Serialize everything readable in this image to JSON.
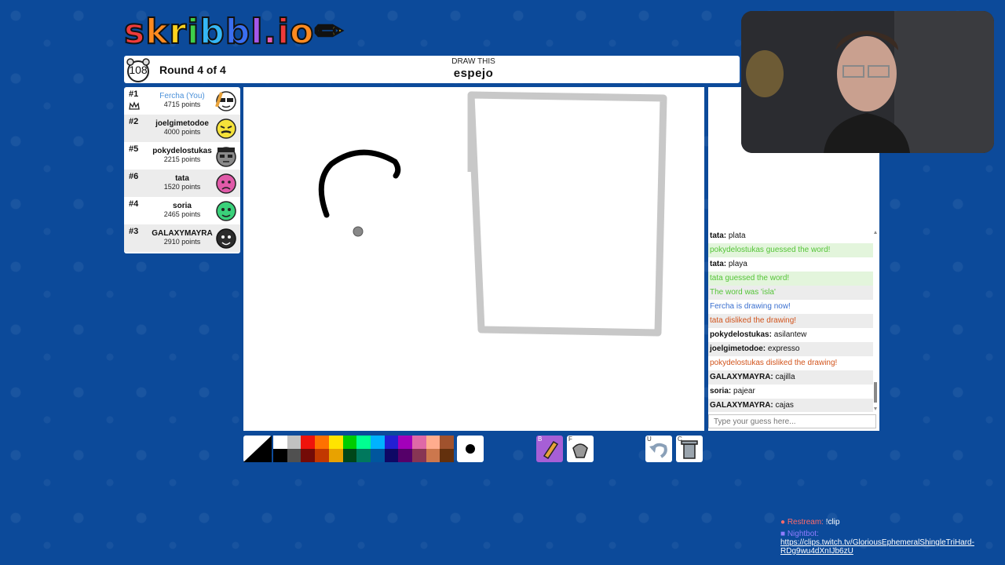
{
  "logo": {
    "text": "skribbl.io"
  },
  "header": {
    "timer": "108",
    "round": "Round 4 of 4",
    "draw_this": "DRAW THIS",
    "word": "espejo"
  },
  "players": [
    {
      "rank": "#1",
      "name": "Fercha (You)",
      "points": "4715 points",
      "you": true,
      "avatar_color": "#ffffff"
    },
    {
      "rank": "#2",
      "name": "joelgimetodoe",
      "points": "4000 points",
      "you": false,
      "avatar_color": "#f5e23a"
    },
    {
      "rank": "#5",
      "name": "pokydelostukas",
      "points": "2215 points",
      "you": false,
      "avatar_color": "#8a8a8a"
    },
    {
      "rank": "#6",
      "name": "tata",
      "points": "1520 points",
      "you": false,
      "avatar_color": "#e05aa8"
    },
    {
      "rank": "#4",
      "name": "soria",
      "points": "2465 points",
      "you": false,
      "avatar_color": "#3ad17a"
    },
    {
      "rank": "#3",
      "name": "GALAXYMAYRA",
      "points": "2910 points",
      "you": false,
      "avatar_color": "#2b2b2b"
    }
  ],
  "chat": {
    "messages": [
      {
        "user": "tata:",
        "text": "plata",
        "style": "normal"
      },
      {
        "user": "",
        "text": "pokydelostukas guessed the word!",
        "style": "green"
      },
      {
        "user": "tata:",
        "text": "playa",
        "style": "normal"
      },
      {
        "user": "",
        "text": "tata guessed the word!",
        "style": "green"
      },
      {
        "user": "",
        "text": "The word was 'isla'",
        "style": "green"
      },
      {
        "user": "",
        "text": "Fercha is drawing now!",
        "style": "blue"
      },
      {
        "user": "",
        "text": "tata disliked the drawing!",
        "style": "orange"
      },
      {
        "user": "pokydelostukas:",
        "text": "asilantew",
        "style": "normal"
      },
      {
        "user": "joelgimetodoe:",
        "text": "expresso",
        "style": "normal"
      },
      {
        "user": "",
        "text": "pokydelostukas disliked the drawing!",
        "style": "orange"
      },
      {
        "user": "GALAXYMAYRA:",
        "text": "cajilla",
        "style": "normal"
      },
      {
        "user": "soria:",
        "text": "pajear",
        "style": "normal"
      },
      {
        "user": "GALAXYMAYRA:",
        "text": "cajas",
        "style": "normal"
      }
    ],
    "guess_placeholder": "Type your guess here..."
  },
  "palette": {
    "top": [
      "#ffffff",
      "#c1c1c1",
      "#ef130b",
      "#ff7100",
      "#ffe400",
      "#00cc00",
      "#00ff91",
      "#00b2ff",
      "#231fd3",
      "#a300ba",
      "#df69a7",
      "#ffac8e",
      "#a0522d"
    ],
    "bottom": [
      "#000000",
      "#505050",
      "#740b07",
      "#c23800",
      "#e8a200",
      "#004619",
      "#00785d",
      "#00569e",
      "#0e0865",
      "#550069",
      "#873554",
      "#cc774d",
      "#63300d"
    ]
  },
  "tools": {
    "brush_hotkey": "B",
    "fill_hotkey": "F",
    "undo_hotkey": "U",
    "clear_hotkey": "C"
  },
  "footer": {
    "restream_name": "Restream:",
    "restream_text": "!clip",
    "nightbot_name": "Nightbot:",
    "nightbot_link": "https://clips.twitch.tv/GloriousEphemeralShingleTriHard-RDg9wu4dXnIJb6zU"
  }
}
